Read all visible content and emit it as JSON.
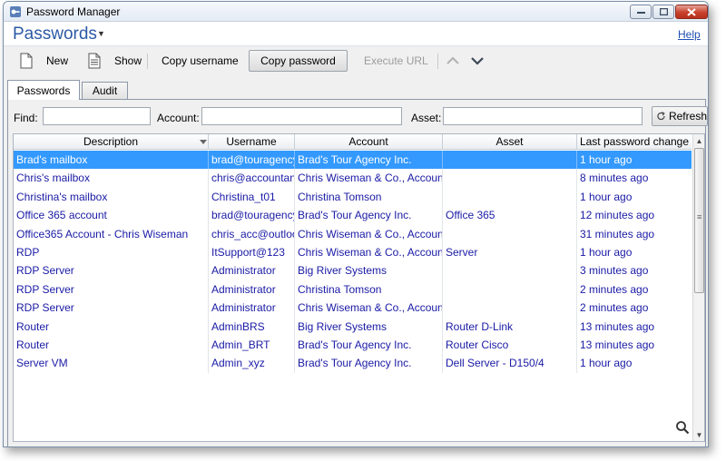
{
  "window": {
    "title": "Password Manager"
  },
  "header": {
    "heading": "Passwords",
    "help_label": "Help"
  },
  "toolbar": {
    "new_label": "New",
    "show_label": "Show",
    "copy_username_label": "Copy username",
    "copy_password_label": "Copy password",
    "execute_url_label": "Execute URL"
  },
  "tabs": [
    {
      "label": "Passwords"
    },
    {
      "label": "Audit"
    }
  ],
  "filters": {
    "find_label": "Find:",
    "find_value": "",
    "account_label": "Account:",
    "account_value": "",
    "asset_label": "Asset:",
    "asset_value": "",
    "refresh_label": "Refresh"
  },
  "grid": {
    "columns": [
      "Description",
      "Username",
      "Account",
      "Asset",
      "Last password change"
    ],
    "rows": [
      [
        "Brad's mailbox",
        "brad@touragency.",
        "Brad's Tour  Agency Inc.",
        "",
        "1 hour ago"
      ],
      [
        "Chris's mailbox",
        "chris@accountant",
        "Chris Wiseman & Co., Accountar",
        "",
        "8 minutes ago"
      ],
      [
        "Christina's mailbox",
        "Christina_t01",
        "Christina Tomson",
        "",
        "1 hour ago"
      ],
      [
        "Office 365 account",
        "brad@touragency.",
        "Brad's Tour  Agency Inc.",
        "Office 365",
        "12 minutes ago"
      ],
      [
        "Office365 Account - Chris Wiseman",
        "chris_acc@outloo",
        "Chris Wiseman & Co., Accountar",
        "",
        "31 minutes ago"
      ],
      [
        "RDP",
        "ItSupport@123",
        "Chris Wiseman & Co., Accountar",
        "Server",
        "1 hour ago"
      ],
      [
        "RDP Server",
        "Administrator",
        "Big River Systems",
        "",
        "3 minutes ago"
      ],
      [
        "RDP Server",
        "Administrator",
        "Christina Tomson",
        "",
        "2 minutes ago"
      ],
      [
        "RDP Server",
        "Administrator",
        "Chris Wiseman & Co., Accountar",
        "",
        "2 minutes ago"
      ],
      [
        "Router",
        "AdminBRS",
        "Big River Systems",
        "Router  D-Link",
        "13 minutes ago"
      ],
      [
        "Router",
        "Admin_BRT",
        "Brad's Tour  Agency Inc.",
        "Router Cisco",
        "13 minutes ago"
      ],
      [
        "Server VM",
        "Admin_xyz",
        "Brad's Tour  Agency Inc.",
        "Dell Server - D150/4",
        "1 hour ago"
      ]
    ],
    "selected_row": 0
  },
  "colors": {
    "heading": "#2c5aa6",
    "row_text": "#1a1aa6",
    "selection": "#3399ff"
  }
}
